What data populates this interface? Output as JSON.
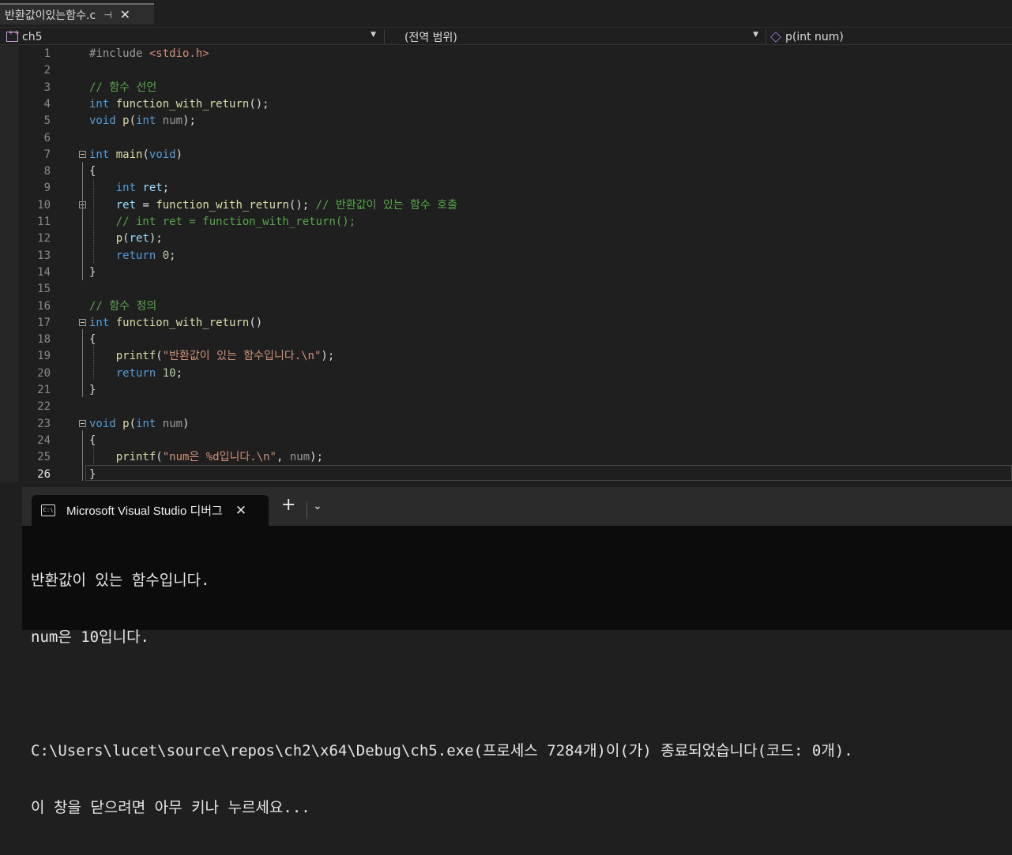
{
  "tab": {
    "filename": "반환값이있는함수.c",
    "pin": "⊣",
    "close": "✕"
  },
  "nav": {
    "project": "ch5",
    "scope": "(전역 범위)",
    "member": "p(int num)"
  },
  "terminal": {
    "title": "Microsoft Visual Studio 디버그",
    "close": "✕",
    "plus": "+",
    "chevron": "⌄",
    "icon_text": "C:\\",
    "output": [
      "반환값이 있는 함수입니다.",
      "num은 10입니다.",
      "",
      "C:\\Users\\lucet\\source\\repos\\ch2\\x64\\Debug\\ch5.exe(프로세스 7284개)이(가) 종료되었습니다(코드: 0개).",
      "이 창을 닫으려면 아무 키나 누르세요..."
    ]
  },
  "code_lines": [
    [
      [
        "pp",
        "#include "
      ],
      [
        "str",
        "<stdio.h>"
      ]
    ],
    [],
    [
      [
        "cm",
        "// 함수 선언"
      ]
    ],
    [
      [
        "kw",
        "int"
      ],
      [
        "pl",
        " "
      ],
      [
        "fn",
        "function_with_return"
      ],
      [
        "pl",
        "();"
      ]
    ],
    [
      [
        "kw",
        "void"
      ],
      [
        "pl",
        " "
      ],
      [
        "fn",
        "p"
      ],
      [
        "pl",
        "("
      ],
      [
        "kw",
        "int"
      ],
      [
        "pl",
        " "
      ],
      [
        "par",
        "num"
      ],
      [
        "pl",
        ");"
      ]
    ],
    [],
    [
      [
        "kw",
        "int"
      ],
      [
        "pl",
        " "
      ],
      [
        "fn",
        "main"
      ],
      [
        "pl",
        "("
      ],
      [
        "kw",
        "void"
      ],
      [
        "pl",
        ")"
      ]
    ],
    [
      [
        "pl",
        "{"
      ]
    ],
    [
      [
        "pl",
        "    "
      ],
      [
        "kw",
        "int"
      ],
      [
        "pl",
        " "
      ],
      [
        "var",
        "ret"
      ],
      [
        "pl",
        ";"
      ]
    ],
    [
      [
        "pl",
        "    "
      ],
      [
        "var",
        "ret"
      ],
      [
        "pl",
        " = "
      ],
      [
        "fn",
        "function_with_return"
      ],
      [
        "pl",
        "(); "
      ],
      [
        "cm",
        "// 반환값이 있는 함수 호출"
      ]
    ],
    [
      [
        "pl",
        "    "
      ],
      [
        "cm",
        "// int ret = function_with_return();"
      ]
    ],
    [
      [
        "pl",
        "    "
      ],
      [
        "fn",
        "p"
      ],
      [
        "pl",
        "("
      ],
      [
        "var",
        "ret"
      ],
      [
        "pl",
        ");"
      ]
    ],
    [
      [
        "pl",
        "    "
      ],
      [
        "kw",
        "return"
      ],
      [
        "pl",
        " "
      ],
      [
        "num",
        "0"
      ],
      [
        "pl",
        ";"
      ]
    ],
    [
      [
        "pl",
        "}"
      ]
    ],
    [],
    [
      [
        "cm",
        "// 함수 정의"
      ]
    ],
    [
      [
        "kw",
        "int"
      ],
      [
        "pl",
        " "
      ],
      [
        "fn",
        "function_with_return"
      ],
      [
        "pl",
        "()"
      ]
    ],
    [
      [
        "pl",
        "{"
      ]
    ],
    [
      [
        "pl",
        "    "
      ],
      [
        "fn",
        "printf"
      ],
      [
        "pl",
        "("
      ],
      [
        "str",
        "\"반환값이 있는 함수입니다.\\n\""
      ],
      [
        "pl",
        ");"
      ]
    ],
    [
      [
        "pl",
        "    "
      ],
      [
        "kw",
        "return"
      ],
      [
        "pl",
        " "
      ],
      [
        "num",
        "10"
      ],
      [
        "pl",
        ";"
      ]
    ],
    [
      [
        "pl",
        "}"
      ]
    ],
    [],
    [
      [
        "kw",
        "void"
      ],
      [
        "pl",
        " "
      ],
      [
        "fn",
        "p"
      ],
      [
        "pl",
        "("
      ],
      [
        "kw",
        "int"
      ],
      [
        "pl",
        " "
      ],
      [
        "par",
        "num"
      ],
      [
        "pl",
        ")"
      ]
    ],
    [
      [
        "pl",
        "{"
      ]
    ],
    [
      [
        "pl",
        "    "
      ],
      [
        "fn",
        "printf"
      ],
      [
        "pl",
        "("
      ],
      [
        "str",
        "\"num은 %d입니다.\\n\""
      ],
      [
        "pl",
        ", "
      ],
      [
        "par",
        "num"
      ],
      [
        "pl",
        ");"
      ]
    ],
    [
      [
        "pl",
        "}"
      ]
    ]
  ],
  "fold_lines": [
    7,
    10,
    17,
    23
  ],
  "current_line": 26
}
